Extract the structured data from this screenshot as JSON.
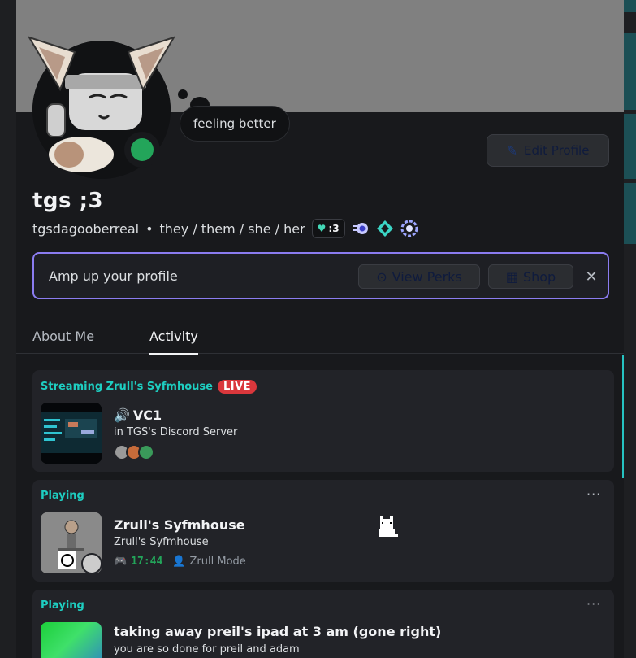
{
  "status": {
    "text": "feeling better"
  },
  "profile": {
    "display_name": "tgs ;3",
    "username": "tgsdagooberreal",
    "separator": "•",
    "pronouns": "they / them / she / her",
    "tag": ":3",
    "edit_label": "Edit Profile"
  },
  "amp": {
    "text": "Amp up your profile",
    "perks_label": "View Perks",
    "shop_label": "Shop",
    "close_glyph": "✕"
  },
  "tabs": [
    {
      "label": "About Me"
    },
    {
      "label": "Activity"
    }
  ],
  "activities": [
    {
      "heading": "Streaming Zrull's Syfmhouse",
      "badge": "LIVE",
      "title": "VC1",
      "subtitle": "in TGS's Discord Server"
    },
    {
      "heading": "Playing",
      "title": "Zrull's Syfmhouse",
      "subtitle": "Zrull's Syfmhouse",
      "time": "17:44",
      "mode": "Zrull Mode",
      "more": "···"
    },
    {
      "heading": "Playing",
      "title": "taking away preil's ipad at 3 am (gone right)",
      "subtitle": "you are so done for preil and adam",
      "more": "···"
    }
  ],
  "colors": {
    "accent_teal": "#1ecec1",
    "online_green": "#23a55a",
    "live_red": "#da373c",
    "amp_border": "#8b7cf0"
  },
  "icons": [
    "pencil-icon",
    "nitro-icon",
    "shop-icon",
    "close-icon",
    "speaker-icon",
    "gamepad-icon",
    "person-icon",
    "more-icon"
  ]
}
